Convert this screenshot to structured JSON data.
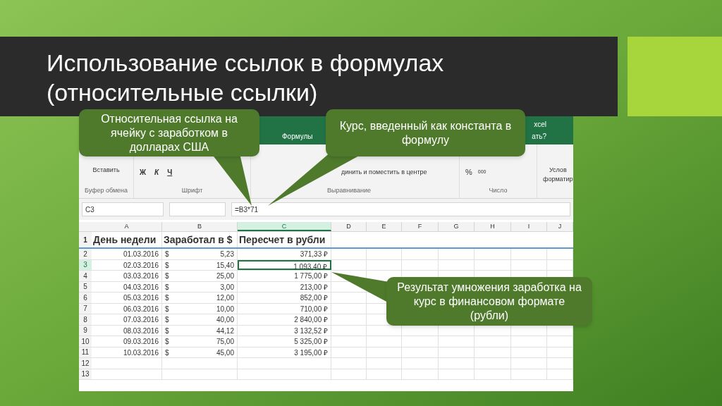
{
  "slide": {
    "title_lines": [
      "Использование ссылок в формулах",
      "(относительные ссылки)"
    ]
  },
  "excel": {
    "title_fragment": "xcel",
    "tabs": [
      {
        "label": "Формулы",
        "selected": false
      }
    ],
    "tell_me": "ать?",
    "ribbon": {
      "paste": "Вставить",
      "bold": "Ж",
      "italic": "К",
      "underline": "Ч",
      "merge": "динить и поместить в центре",
      "percent": "%",
      "thousands": "000",
      "conditional_lines": [
        "Услов",
        "форматир"
      ],
      "groups": [
        "Буфер обмена",
        "Шрифт",
        "Выравнивание",
        "Число"
      ]
    },
    "name_box": "C3",
    "formula": "=B3*71",
    "columns": [
      {
        "label": "A",
        "selected": false
      },
      {
        "label": "B",
        "selected": false
      },
      {
        "label": "C",
        "selected": true
      },
      {
        "label": "D",
        "selected": false
      },
      {
        "label": "E",
        "selected": false
      },
      {
        "label": "F",
        "selected": false
      },
      {
        "label": "G",
        "selected": false
      },
      {
        "label": "H",
        "selected": false
      },
      {
        "label": "I",
        "selected": false
      },
      {
        "label": "J",
        "selected": false
      }
    ],
    "header_row": {
      "number": "1",
      "cells": [
        "День недели",
        "Заработал в $",
        "Пересчет в рубли"
      ]
    },
    "rows": [
      {
        "number": "2",
        "date": "01.03.2016",
        "currency": "$",
        "usd": "5,23",
        "rub": "371,33 ₽",
        "selected": false
      },
      {
        "number": "3",
        "date": "02.03.2016",
        "currency": "$",
        "usd": "15,40",
        "rub": "1 093,40 ₽",
        "selected": true
      },
      {
        "number": "4",
        "date": "03.03.2016",
        "currency": "$",
        "usd": "25,00",
        "rub": "1 775,00 ₽",
        "selected": false
      },
      {
        "number": "5",
        "date": "04.03.2016",
        "currency": "$",
        "usd": "3,00",
        "rub": "213,00 ₽",
        "selected": false
      },
      {
        "number": "6",
        "date": "05.03.2016",
        "currency": "$",
        "usd": "12,00",
        "rub": "852,00 ₽",
        "selected": false
      },
      {
        "number": "7",
        "date": "06.03.2016",
        "currency": "$",
        "usd": "10,00",
        "rub": "710,00 ₽",
        "selected": false
      },
      {
        "number": "8",
        "date": "07.03.2016",
        "currency": "$",
        "usd": "40,00",
        "rub": "2 840,00 ₽",
        "selected": false
      },
      {
        "number": "9",
        "date": "08.03.2016",
        "currency": "$",
        "usd": "44,12",
        "rub": "3 132,52 ₽",
        "selected": false
      },
      {
        "number": "10",
        "date": "09.03.2016",
        "currency": "$",
        "usd": "75,00",
        "rub": "5 325,00 ₽",
        "selected": false
      },
      {
        "number": "11",
        "date": "10.03.2016",
        "currency": "$",
        "usd": "45,00",
        "rub": "3 195,00 ₽",
        "selected": false
      }
    ],
    "empty_rows": [
      "12",
      "13"
    ]
  },
  "callouts": [
    {
      "text": "Относительная ссылка на ячейку с заработком в долларах США"
    },
    {
      "text": "Курс, введенный как константа в формулу"
    },
    {
      "text": "Результат умножения заработка на курс в финансовом формате (рубли)"
    }
  ]
}
